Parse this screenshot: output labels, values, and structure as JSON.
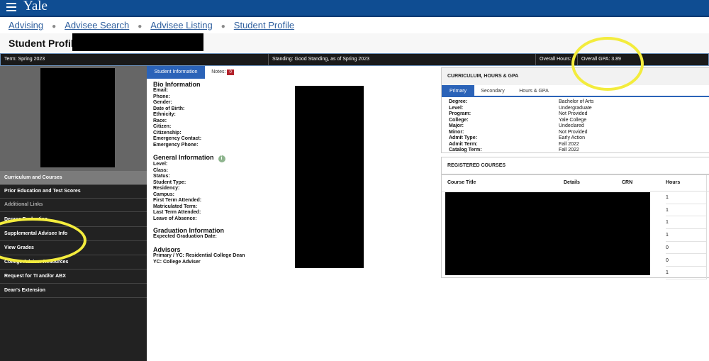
{
  "header": {
    "logo": "Yale",
    "breadcrumbs": [
      "Advising",
      "Advisee Search",
      "Advisee Listing",
      "Student Profile"
    ],
    "page_title": "Student Profile"
  },
  "statusbar": {
    "term": "Term: Spring 2023",
    "standing": "Standing: Good Standing, as of Spring 2023",
    "hours": "Overall Hours:",
    "gpa": "Overall GPA: 3.89"
  },
  "sidebar": {
    "items": [
      {
        "label": "Curriculum and Courses"
      },
      {
        "label": "Prior Education and Test Scores"
      },
      {
        "label": "Additional Links"
      },
      {
        "label": "Degree Evaluation"
      },
      {
        "label": "Supplemental Advisee Info"
      },
      {
        "label": "View Grades"
      },
      {
        "label": "College Adviser Resources"
      },
      {
        "label": "Request for TI and/or ABX"
      },
      {
        "label": "Dean's Extension"
      }
    ]
  },
  "center": {
    "tabs": {
      "student_info": "Student Information",
      "notes": "Notes:",
      "notes_count": "0"
    },
    "bio": {
      "heading": "Bio Information",
      "fields": [
        "Email:",
        "Phone:",
        "Gender:",
        "Date of Birth:",
        "Ethnicity:",
        "Race:",
        "Citizen:",
        "Citizenship:",
        "Emergency Contact:",
        "Emergency Phone:"
      ]
    },
    "general": {
      "heading": "General Information",
      "fields": [
        "Level:",
        "Class:",
        "Status:",
        "Student Type:",
        "Residency:",
        "Campus:",
        "First Term Attended:",
        "Matriculated Term:",
        "Last Term Attended:",
        "Leave of Absence:"
      ]
    },
    "graduation": {
      "heading": "Graduation Information",
      "fields": [
        "Expected Graduation Date:"
      ]
    },
    "advisors": {
      "heading": "Advisors",
      "fields": [
        "Primary / YC: Residential College Dean",
        "YC: College Adviser"
      ]
    }
  },
  "curriculum": {
    "heading": "CURRICULUM, HOURS & GPA",
    "tabs": [
      "Primary",
      "Secondary",
      "Hours & GPA"
    ],
    "rows": [
      {
        "k": "Degree:",
        "v": "Bachelor of Arts"
      },
      {
        "k": "Level:",
        "v": "Undergraduate"
      },
      {
        "k": "Program:",
        "v": "Not Provided"
      },
      {
        "k": "College:",
        "v": "Yale College"
      },
      {
        "k": "Major:",
        "v": "Undeclared"
      },
      {
        "k": "Minor:",
        "v": "Not Provided"
      },
      {
        "k": "Admit Type:",
        "v": "Early Action"
      },
      {
        "k": "Admit Term:",
        "v": "Fall 2022"
      },
      {
        "k": "Catalog Term:",
        "v": "Fall 2022"
      }
    ]
  },
  "registered": {
    "heading": "REGISTERED COURSES",
    "columns": [
      "Course Title",
      "Details",
      "CRN",
      "Hours"
    ],
    "hours": [
      "1",
      "1",
      "1",
      "1",
      "0",
      "0",
      "1"
    ]
  },
  "colors": {
    "brand": "#0f4d92",
    "tab_active": "#2b63b8",
    "highlight": "#f3ec3d"
  }
}
